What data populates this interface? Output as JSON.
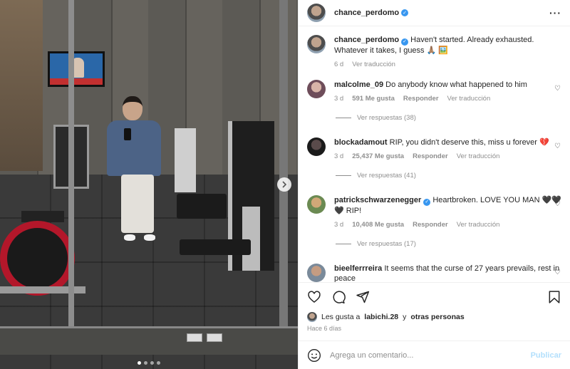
{
  "post": {
    "author": "chance_perdomo",
    "more_icon": "more-horizontal-icon",
    "photo_dots": 4,
    "active_dot": 0,
    "next_icon": "chevron-right-icon"
  },
  "caption": {
    "username": "chance_perdomo",
    "text": "Haven't started. Already exhausted. Whatever it takes, I guess 🙏🏽 🖼️",
    "age": "6 d",
    "translate": "Ver traducción"
  },
  "comments": [
    {
      "username": "malcolme_09",
      "verified": false,
      "text": "Do anybody know what happened to him",
      "age": "3 d",
      "likes": "591 Me gusta",
      "reply": "Responder",
      "translate": "Ver traducción",
      "replies": "Ver respuestas (38)"
    },
    {
      "username": "blockadamout",
      "verified": false,
      "text": "RIP, you didn't deserve this, miss u forever 💔",
      "age": "3 d",
      "likes": "25,437 Me gusta",
      "reply": "Responder",
      "translate": "Ver traducción",
      "replies": "Ver respuestas (41)"
    },
    {
      "username": "patrickschwarzenegger",
      "verified": true,
      "text": "Heartbroken. LOVE YOU MAN 🖤🖤 🖤 RIP!",
      "age": "3 d",
      "likes": "10,408 Me gusta",
      "reply": "Responder",
      "translate": "Ver traducción",
      "replies": "Ver respuestas (17)"
    },
    {
      "username": "bieelferrreira",
      "verified": false,
      "text": "It seems that the curse of 27 years prevails, rest in peace"
    }
  ],
  "likes_line": {
    "prefix": "Les gusta a",
    "user": "labichi.28",
    "joiner": "y",
    "others": "otras personas"
  },
  "posted_ago": "Hace 6 días",
  "comment_box": {
    "placeholder": "Agrega un comentario...",
    "publish": "Publicar",
    "emoji_icon": "emoji-smile-icon"
  },
  "colors": {
    "verified": "#3897f0",
    "publish_disabled": "#b2dffc",
    "muted_text": "#8e8e8e"
  }
}
